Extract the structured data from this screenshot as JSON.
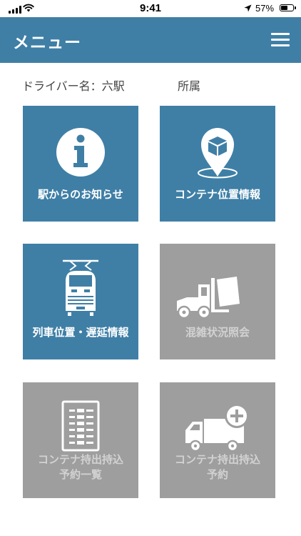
{
  "status_bar": {
    "time": "9:41",
    "battery_percent": "57%",
    "battery_level": 0.57,
    "icons": [
      "signal-icon",
      "wifi-icon",
      "location-arrow-icon",
      "battery-icon"
    ]
  },
  "header": {
    "title": "メニュー",
    "menu_icon": "hamburger-menu-icon",
    "background_color": "#3f7fa6"
  },
  "driver": {
    "driver_label": "ドライバー名：六駅",
    "affiliation_label": "所属"
  },
  "colors": {
    "active_tile": "#3f7fa6",
    "disabled_tile": "#9e9e9e",
    "disabled_text": "#d2d2d2"
  },
  "tiles": [
    {
      "label": "駅からのお知らせ",
      "icon": "info-icon",
      "enabled": true
    },
    {
      "label": "コンテナ位置情報",
      "icon": "container-location-pin-icon",
      "enabled": true
    },
    {
      "label": "列車位置・遅延情報",
      "icon": "train-icon",
      "enabled": true
    },
    {
      "label": "混雑状況照会",
      "icon": "forklift-icon",
      "enabled": false
    },
    {
      "label_line1": "コンテナ持出持込",
      "label_line2": "予約一覧",
      "icon": "reservation-list-icon",
      "enabled": false
    },
    {
      "label_line1": "コンテナ持出持込",
      "label_line2": "予約",
      "icon": "truck-add-icon",
      "enabled": false
    }
  ]
}
